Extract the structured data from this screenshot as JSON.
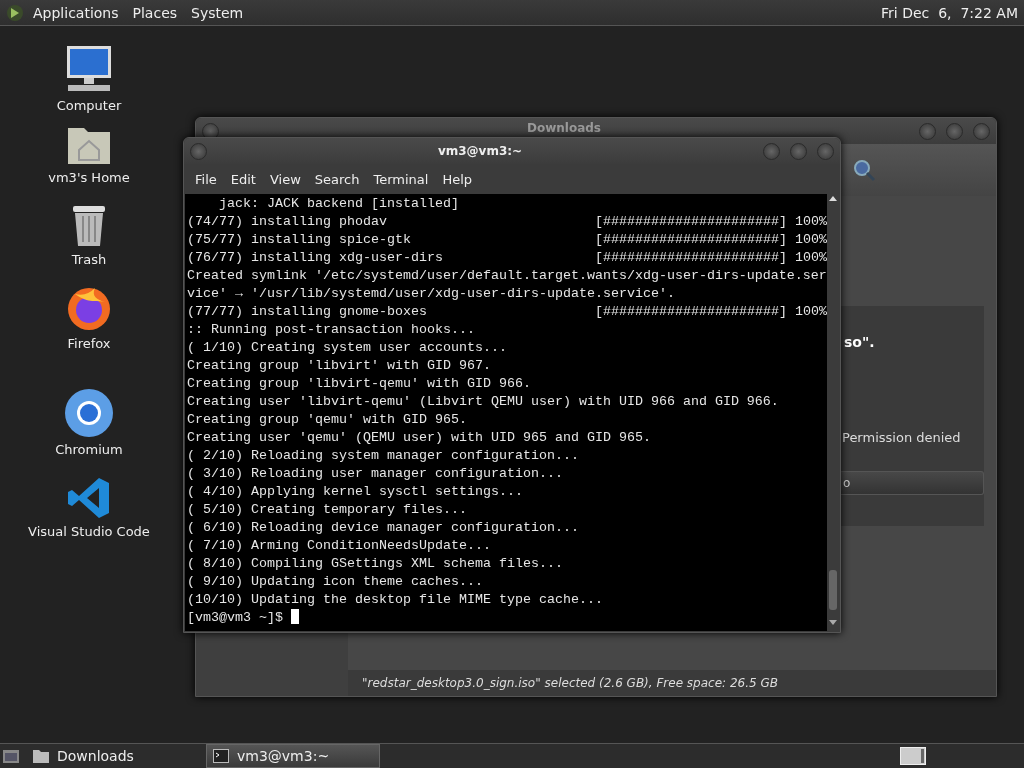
{
  "top_panel": {
    "menus": [
      "Applications",
      "Places",
      "System"
    ],
    "clock": "Fri Dec  6,  7:22 AM"
  },
  "desktop_icons": [
    {
      "label": "Computer",
      "kind": "computer"
    },
    {
      "label": "vm3's Home",
      "kind": "home"
    },
    {
      "label": "Trash",
      "kind": "trash"
    },
    {
      "label": "Firefox",
      "kind": "firefox"
    },
    {
      "label": "Chromium",
      "kind": "chromium"
    },
    {
      "label": "Visual Studio Code",
      "kind": "vscode"
    }
  ],
  "downloads_window": {
    "title": "Downloads",
    "message_end": "so\".",
    "error_text": "Permission denied",
    "button_label": "o",
    "status": "\"redstar_desktop3.0_sign.iso\" selected (2.6 GB), Free space: 26.5 GB"
  },
  "terminal": {
    "title": "vm3@vm3:~",
    "menu": [
      "File",
      "Edit",
      "View",
      "Search",
      "Terminal",
      "Help"
    ],
    "lines": [
      {
        "kind": "text",
        "text": "    jack: JACK backend [installed]"
      },
      {
        "kind": "progress",
        "text": "(74/77) installing phodav",
        "bar": "[######################]",
        "percent": "100%"
      },
      {
        "kind": "progress",
        "text": "(75/77) installing spice-gtk",
        "bar": "[######################]",
        "percent": "100%"
      },
      {
        "kind": "progress",
        "text": "(76/77) installing xdg-user-dirs",
        "bar": "[######################]",
        "percent": "100%"
      },
      {
        "kind": "text",
        "text": "Created symlink '/etc/systemd/user/default.target.wants/xdg-user-dirs-update.ser"
      },
      {
        "kind": "text",
        "text": "vice' → '/usr/lib/systemd/user/xdg-user-dirs-update.service'."
      },
      {
        "kind": "progress",
        "text": "(77/77) installing gnome-boxes",
        "bar": "[######################]",
        "percent": "100%"
      },
      {
        "kind": "text",
        "text": ":: Running post-transaction hooks..."
      },
      {
        "kind": "text",
        "text": "( 1/10) Creating system user accounts..."
      },
      {
        "kind": "text",
        "text": "Creating group 'libvirt' with GID 967."
      },
      {
        "kind": "text",
        "text": "Creating group 'libvirt-qemu' with GID 966."
      },
      {
        "kind": "text",
        "text": "Creating user 'libvirt-qemu' (Libvirt QEMU user) with UID 966 and GID 966."
      },
      {
        "kind": "text",
        "text": "Creating group 'qemu' with GID 965."
      },
      {
        "kind": "text",
        "text": "Creating user 'qemu' (QEMU user) with UID 965 and GID 965."
      },
      {
        "kind": "text",
        "text": "( 2/10) Reloading system manager configuration..."
      },
      {
        "kind": "text",
        "text": "( 3/10) Reloading user manager configuration..."
      },
      {
        "kind": "text",
        "text": "( 4/10) Applying kernel sysctl settings..."
      },
      {
        "kind": "text",
        "text": "( 5/10) Creating temporary files..."
      },
      {
        "kind": "text",
        "text": "( 6/10) Reloading device manager configuration..."
      },
      {
        "kind": "text",
        "text": "( 7/10) Arming ConditionNeedsUpdate..."
      },
      {
        "kind": "text",
        "text": "( 8/10) Compiling GSettings XML schema files..."
      },
      {
        "kind": "text",
        "text": "( 9/10) Updating icon theme caches..."
      },
      {
        "kind": "text",
        "text": "(10/10) Updating the desktop file MIME type cache..."
      }
    ],
    "prompt": "[vm3@vm3 ~]$"
  },
  "taskbar": [
    {
      "label": "Downloads",
      "kind": "folder",
      "selected": false
    },
    {
      "label": "vm3@vm3:~",
      "kind": "terminal",
      "selected": true
    }
  ]
}
